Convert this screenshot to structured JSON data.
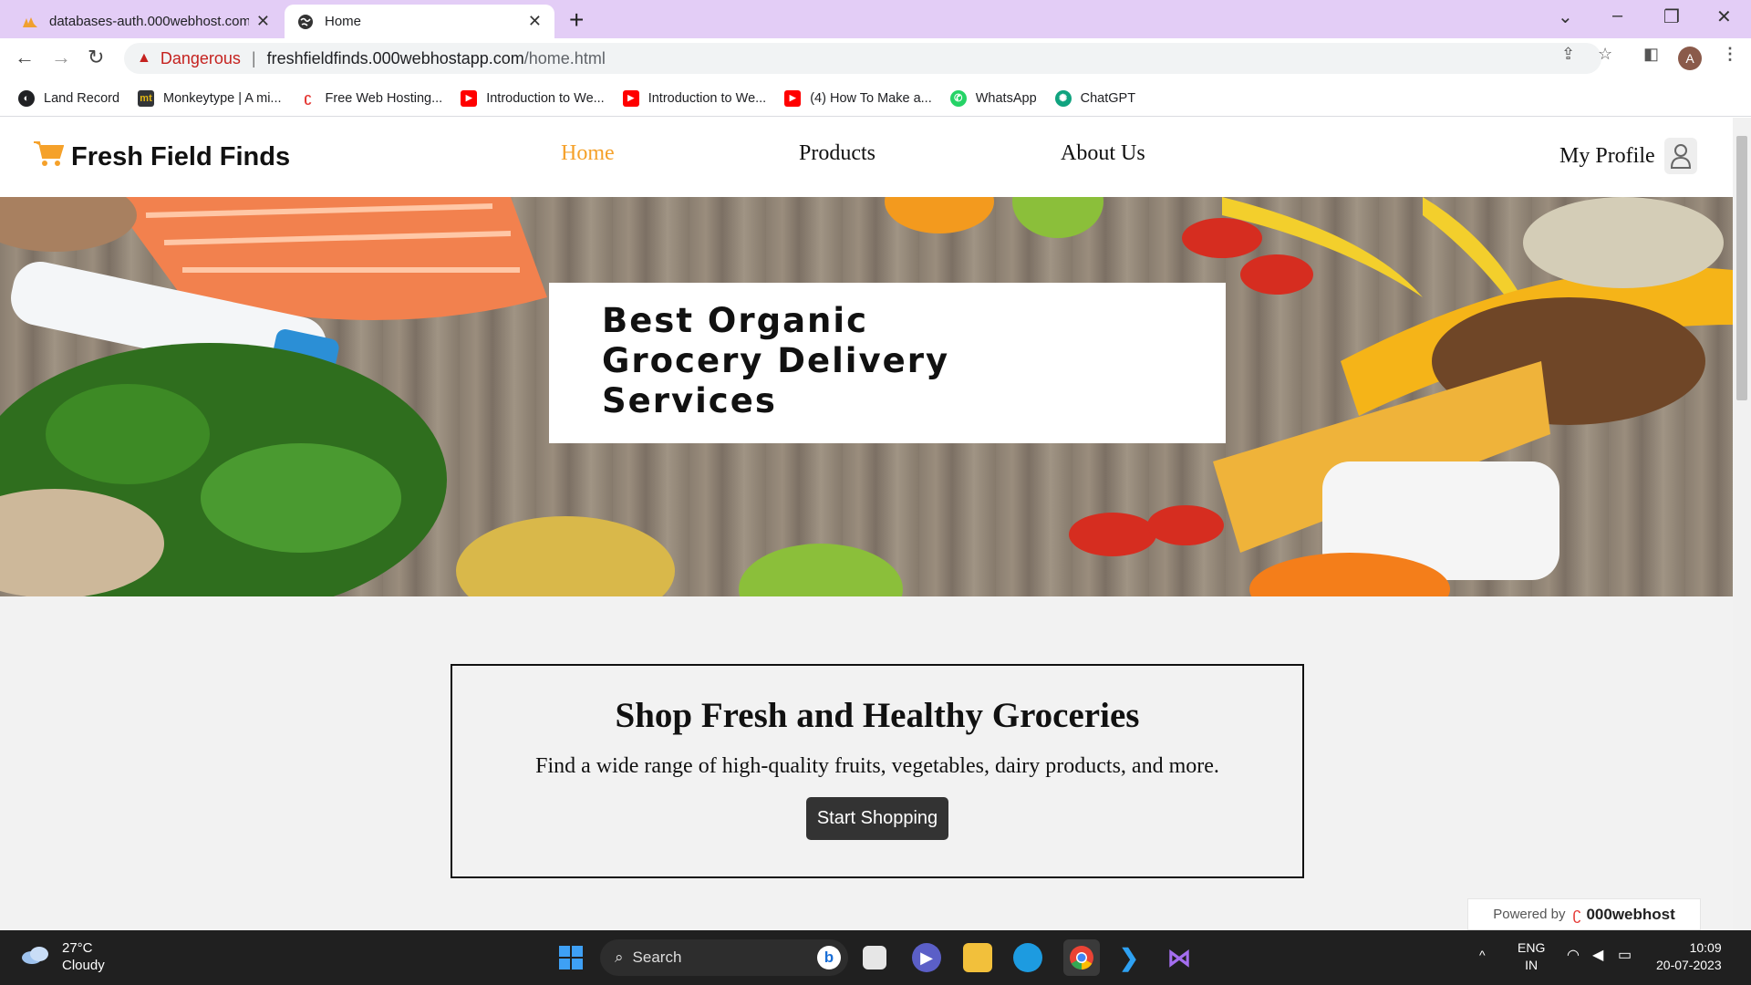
{
  "browser": {
    "tabs": [
      {
        "title": "databases-auth.000webhost.com",
        "active": false,
        "icon": "phpmyadmin-icon"
      },
      {
        "title": "Home",
        "active": true,
        "icon": "globe-icon"
      }
    ],
    "omnibox": {
      "security_label": "Dangerous",
      "url_host": "freshfieldfinds.000webhostapp.com",
      "url_path": "/home.html"
    },
    "profile_initial": "A",
    "bookmarks": [
      {
        "label": "Land Record",
        "icon": "globe-icon",
        "color": "#202124"
      },
      {
        "label": "Monkeytype | A mi...",
        "icon": "monkeytype-icon",
        "color": "#e2b714"
      },
      {
        "label": "Free Web Hosting...",
        "icon": "000webhost-icon",
        "color": "#e53935"
      },
      {
        "label": "Introduction to We...",
        "icon": "youtube-icon",
        "color": "#ff0000"
      },
      {
        "label": "Introduction to We...",
        "icon": "youtube-icon",
        "color": "#ff0000"
      },
      {
        "label": "(4) How To Make a...",
        "icon": "youtube-icon",
        "color": "#ff0000"
      },
      {
        "label": "WhatsApp",
        "icon": "whatsapp-icon",
        "color": "#25d366"
      },
      {
        "label": "ChatGPT",
        "icon": "chatgpt-icon",
        "color": "#10a37f"
      }
    ]
  },
  "site": {
    "brand": "Fresh Field Finds",
    "nav": {
      "home": "Home",
      "products": "Products",
      "about": "About Us",
      "profile": "My Profile"
    },
    "accent_color": "#f5a12a",
    "hero": {
      "headline": "Best Organic\nGrocery Delivery\nServices"
    },
    "promo": {
      "title": "Shop Fresh and Healthy Groceries",
      "text": "Find a wide range of high-quality fruits, vegetables, dairy products, and more.",
      "button": "Start Shopping"
    },
    "powered": {
      "prefix": "Powered by",
      "brand": "000webhost"
    }
  },
  "taskbar": {
    "weather": {
      "temp": "27°C",
      "condition": "Cloudy"
    },
    "search_label": "Search",
    "language": {
      "lang": "ENG",
      "region": "IN"
    },
    "clock": {
      "time": "10:09",
      "date": "20-07-2023"
    }
  }
}
